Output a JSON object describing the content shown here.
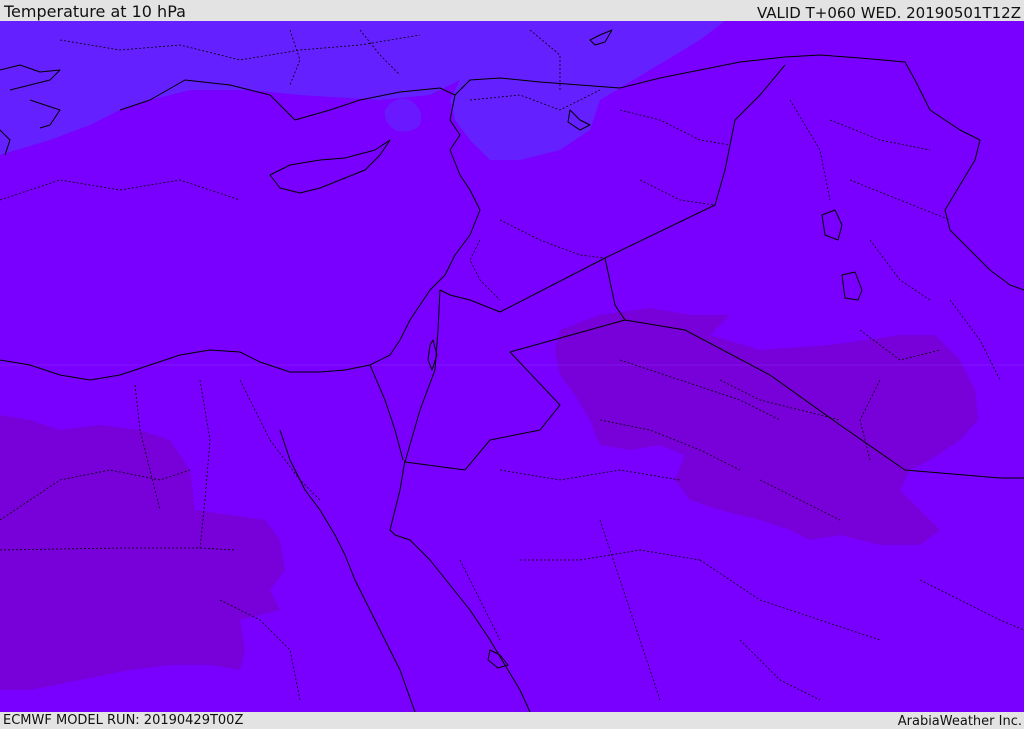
{
  "header": {
    "title": "Temperature at 10 hPa",
    "valid": "VALID T+060 WED. 20190501T12Z"
  },
  "footer": {
    "model_run": "ECMWF MODEL RUN: 20190429T00Z",
    "credit": "ArabiaWeather Inc."
  },
  "colors": {
    "field_base": "#7900fe",
    "field_cold_north": "#6520ff",
    "field_warm_patch": "#7800d8",
    "coastline": "#000000",
    "borders_dotted": "#000000",
    "frame": "#e3e3e3"
  }
}
